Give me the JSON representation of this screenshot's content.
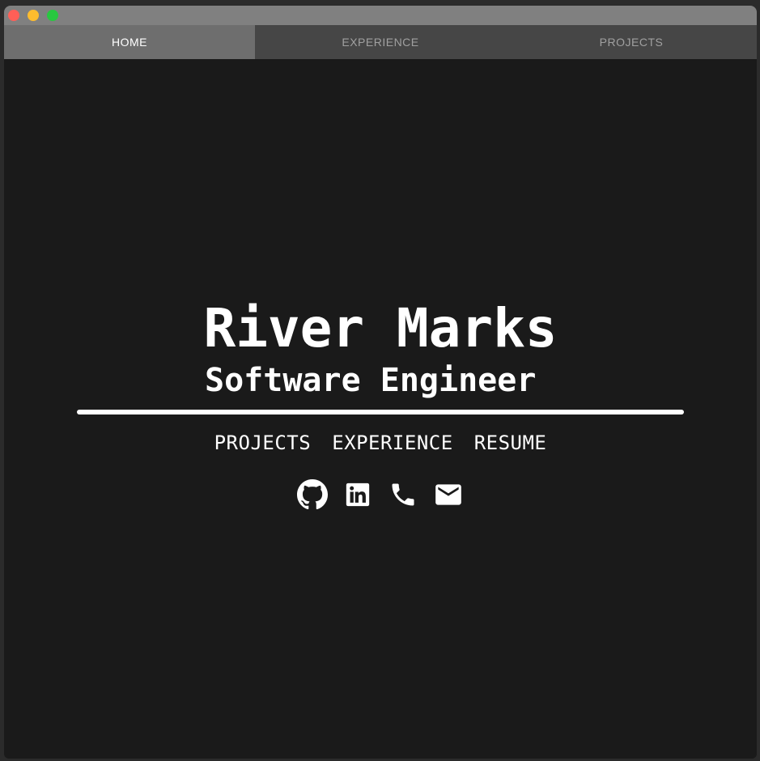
{
  "window": {
    "controls": {
      "close_color": "#ff5f57",
      "minimize_color": "#febc2e",
      "maximize_color": "#28c840"
    }
  },
  "tabs": [
    {
      "label": "HOME",
      "active": true
    },
    {
      "label": "EXPERIENCE",
      "active": false
    },
    {
      "label": "PROJECTS",
      "active": false
    }
  ],
  "hero": {
    "name": "River Marks",
    "title": "Software Engineer",
    "links": [
      {
        "label": "PROJECTS"
      },
      {
        "label": "EXPERIENCE"
      },
      {
        "label": "RESUME"
      }
    ],
    "socials": [
      {
        "icon": "github-icon"
      },
      {
        "icon": "linkedin-icon"
      },
      {
        "icon": "phone-icon"
      },
      {
        "icon": "email-icon"
      }
    ]
  },
  "colors": {
    "background": "#1a1a1a",
    "text": "#ffffff",
    "active_tab": "#6e6e6e",
    "tab_bar": "#464646",
    "title_bar": "#808080"
  }
}
